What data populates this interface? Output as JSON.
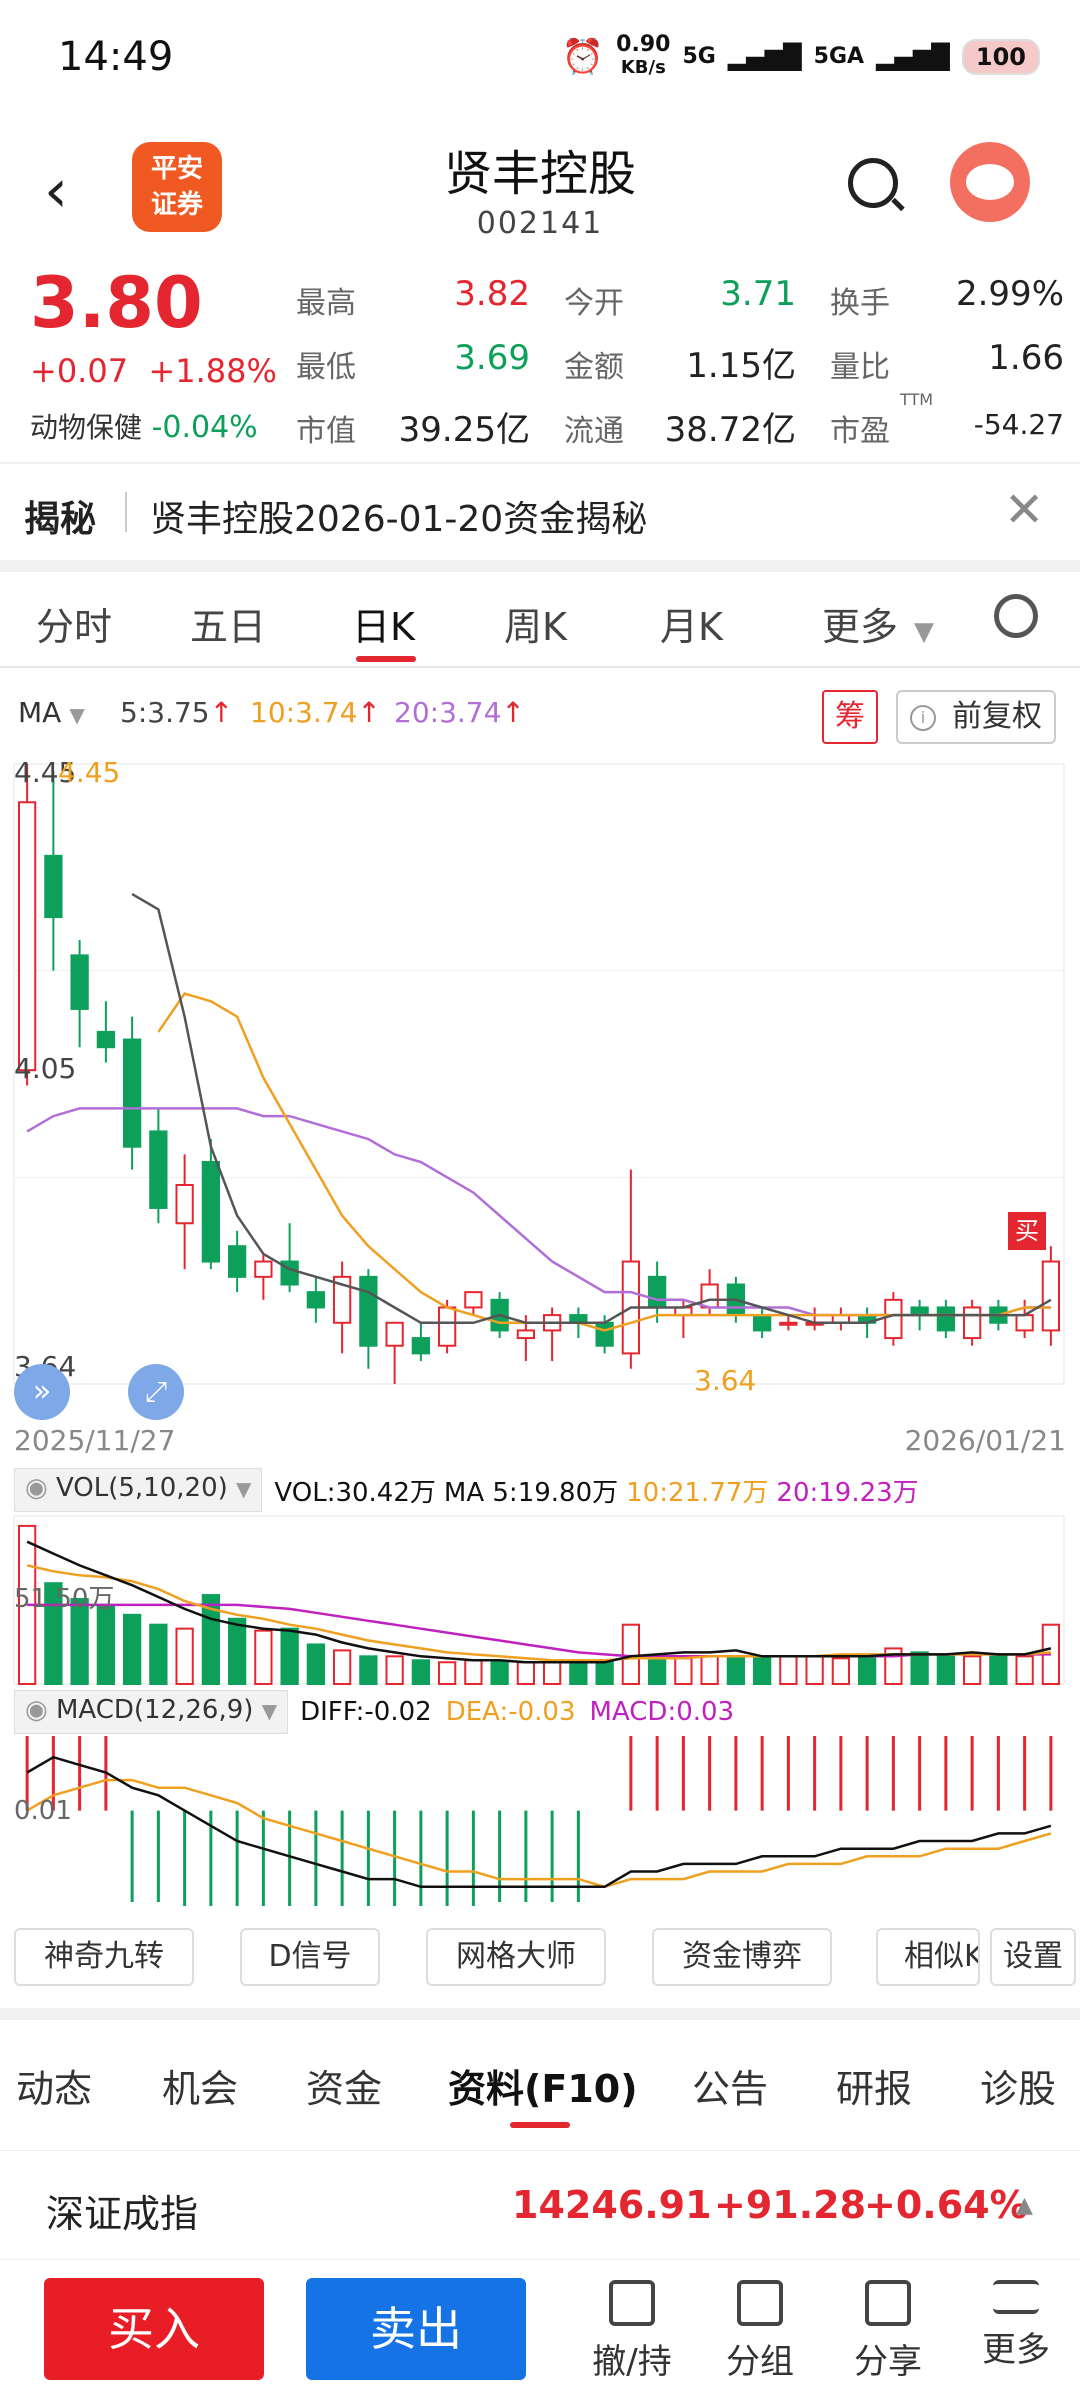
{
  "status": {
    "time": "14:49",
    "net_speed": "0.90",
    "net_unit": "KB/s",
    "sig1": "5G",
    "sig2": "5GA",
    "battery": "100"
  },
  "header": {
    "brand_line1": "平安",
    "brand_line2": "证券",
    "title": "贤丰控股",
    "code": "002141"
  },
  "quote": {
    "price": "3.80",
    "change": "+0.07",
    "change_pct": "+1.88%",
    "animal_label": "动物保健",
    "animal_value": "-0.04%",
    "fields": [
      {
        "label": "最高",
        "value": "3.82"
      },
      {
        "label": "最低",
        "value": "3.69"
      },
      {
        "label": "市值",
        "value": "39.25亿"
      },
      {
        "label": "今开",
        "value": "3.71"
      },
      {
        "label": "金额",
        "value": "1.15亿"
      },
      {
        "label": "流通",
        "value": "38.72亿"
      },
      {
        "label": "换手",
        "value": "2.99%"
      },
      {
        "label": "量比",
        "value": "1.66"
      },
      {
        "label": "市盈",
        "value": "-54.27",
        "sup": "TTM"
      }
    ]
  },
  "reveal": {
    "tag": "揭秘",
    "text": "贤丰控股2026-01-20资金揭秘"
  },
  "ktabs": [
    "分时",
    "五日",
    "日K",
    "周K",
    "月K",
    "更多"
  ],
  "ma": {
    "label": "MA",
    "ma5": "5:3.75",
    "ma10": "10:3.74",
    "ma20": "20:3.74",
    "chou": "筹",
    "fq": "前复权"
  },
  "kchart": {
    "high_label": "4.45",
    "high_mark": "4.45",
    "mid_label": "4.05",
    "low_label": "3.64",
    "low_mark": "3.64",
    "date_start": "2025/11/27",
    "date_end": "2026/01/21",
    "buy_tag": "买"
  },
  "vol": {
    "box": "VOL(5,10,20)",
    "vol": "VOL:30.42万",
    "ma5": "MA 5:19.80万",
    "ma10": "10:21.77万",
    "ma20": "20:19.23万",
    "axis": "51.50万"
  },
  "macd": {
    "box": "MACD(12,26,9)",
    "diff": "DIFF:-0.02",
    "dea": "DEA:-0.03",
    "macd": "MACD:0.03",
    "axis": "0.01"
  },
  "tools": [
    "神奇九转",
    "D信号",
    "网格大师",
    "资金博弈",
    "相似K",
    "设置"
  ],
  "itabs": [
    "动态",
    "机会",
    "资金",
    "资料(F10)",
    "公告",
    "研报",
    "诊股"
  ],
  "index": {
    "name": "深证成指",
    "value": "14246.91",
    "change": "+91.28",
    "pct": "+0.64%"
  },
  "bottom": {
    "buy": "买入",
    "sell": "卖出",
    "items": [
      "撤/持",
      "分组",
      "分享",
      "更多"
    ]
  },
  "colors": {
    "up": "#e3262f",
    "down": "#0ca05a",
    "ma5": "#555555",
    "ma10": "#f0a020",
    "ma20": "#b06ed6"
  },
  "chart_data": {
    "type": "candlestick",
    "ohlc": [
      [
        4.05,
        4.45,
        4.03,
        4.4
      ],
      [
        4.33,
        4.44,
        4.18,
        4.25
      ],
      [
        4.2,
        4.22,
        4.08,
        4.13
      ],
      [
        4.1,
        4.14,
        4.06,
        4.08
      ],
      [
        4.09,
        4.12,
        3.92,
        3.95
      ],
      [
        3.97,
        4.0,
        3.85,
        3.87
      ],
      [
        3.85,
        3.94,
        3.79,
        3.9
      ],
      [
        3.93,
        3.96,
        3.79,
        3.8
      ],
      [
        3.82,
        3.84,
        3.76,
        3.78
      ],
      [
        3.78,
        3.81,
        3.75,
        3.8
      ],
      [
        3.8,
        3.85,
        3.76,
        3.77
      ],
      [
        3.76,
        3.78,
        3.72,
        3.74
      ],
      [
        3.72,
        3.8,
        3.68,
        3.78
      ],
      [
        3.78,
        3.79,
        3.66,
        3.69
      ],
      [
        3.69,
        3.72,
        3.64,
        3.72
      ],
      [
        3.7,
        3.72,
        3.67,
        3.68
      ],
      [
        3.69,
        3.75,
        3.68,
        3.74
      ],
      [
        3.74,
        3.76,
        3.73,
        3.76
      ],
      [
        3.75,
        3.76,
        3.7,
        3.71
      ],
      [
        3.7,
        3.73,
        3.67,
        3.71
      ],
      [
        3.71,
        3.74,
        3.67,
        3.73
      ],
      [
        3.73,
        3.74,
        3.7,
        3.72
      ],
      [
        3.72,
        3.73,
        3.68,
        3.69
      ],
      [
        3.68,
        3.92,
        3.66,
        3.8
      ],
      [
        3.78,
        3.8,
        3.72,
        3.74
      ],
      [
        3.73,
        3.75,
        3.7,
        3.74
      ],
      [
        3.74,
        3.79,
        3.73,
        3.77
      ],
      [
        3.77,
        3.78,
        3.72,
        3.73
      ],
      [
        3.73,
        3.74,
        3.7,
        3.71
      ],
      [
        3.72,
        3.73,
        3.71,
        3.72
      ],
      [
        3.72,
        3.74,
        3.71,
        3.72
      ],
      [
        3.72,
        3.74,
        3.71,
        3.73
      ],
      [
        3.73,
        3.74,
        3.7,
        3.72
      ],
      [
        3.7,
        3.76,
        3.69,
        3.75
      ],
      [
        3.74,
        3.75,
        3.71,
        3.73
      ],
      [
        3.74,
        3.75,
        3.7,
        3.71
      ],
      [
        3.7,
        3.75,
        3.69,
        3.74
      ],
      [
        3.74,
        3.75,
        3.71,
        3.72
      ],
      [
        3.71,
        3.75,
        3.7,
        3.73
      ],
      [
        3.71,
        3.82,
        3.69,
        3.8
      ]
    ],
    "ma5": [
      null,
      null,
      null,
      null,
      4.28,
      4.26,
      4.12,
      3.95,
      3.86,
      3.81,
      3.79,
      3.78,
      3.77,
      3.76,
      3.74,
      3.72,
      3.72,
      3.72,
      3.73,
      3.72,
      3.72,
      3.72,
      3.72,
      3.74,
      3.74,
      3.74,
      3.75,
      3.75,
      3.74,
      3.73,
      3.72,
      3.72,
      3.72,
      3.73,
      3.73,
      3.73,
      3.73,
      3.73,
      3.73,
      3.75
    ],
    "ma10": [
      null,
      null,
      null,
      null,
      null,
      4.1,
      4.15,
      4.14,
      4.12,
      4.04,
      3.98,
      3.92,
      3.86,
      3.82,
      3.79,
      3.76,
      3.74,
      3.73,
      3.72,
      3.72,
      3.72,
      3.72,
      3.71,
      3.72,
      3.73,
      3.73,
      3.73,
      3.73,
      3.73,
      3.73,
      3.73,
      3.73,
      3.73,
      3.73,
      3.73,
      3.73,
      3.73,
      3.73,
      3.74,
      3.74
    ],
    "ma20": [
      3.97,
      3.99,
      4.0,
      4.0,
      4.0,
      4.0,
      4.0,
      4.0,
      4.0,
      3.99,
      3.99,
      3.98,
      3.97,
      3.96,
      3.94,
      3.93,
      3.91,
      3.89,
      3.86,
      3.83,
      3.8,
      3.78,
      3.76,
      3.76,
      3.75,
      3.75,
      3.74,
      3.74,
      3.74,
      3.74,
      3.73,
      3.73,
      3.73,
      3.73,
      3.73,
      3.73,
      3.73,
      3.73,
      3.74,
      3.74
    ],
    "vol": [
      80,
      51,
      43,
      40,
      35,
      30,
      28,
      45,
      33,
      27,
      28,
      20,
      17,
      14,
      14,
      12,
      11,
      12,
      11,
      11,
      11,
      12,
      11,
      30,
      14,
      13,
      14,
      14,
      13,
      14,
      14,
      13,
      15,
      18,
      16,
      15,
      14,
      14,
      14,
      30
    ],
    "vol_ma5": [
      72,
      66,
      60,
      55,
      50,
      44,
      38,
      33,
      30,
      28,
      27,
      25,
      21,
      18,
      16,
      14,
      13,
      12,
      12,
      11,
      11,
      11,
      11,
      14,
      15,
      16,
      16,
      17,
      14,
      14,
      14,
      14,
      14,
      15,
      15,
      15,
      16,
      15,
      15,
      18
    ],
    "vol_ma10": [
      60,
      57,
      55,
      54,
      52,
      48,
      42,
      38,
      35,
      33,
      30,
      28,
      25,
      22,
      20,
      18,
      16,
      15,
      14,
      13,
      12,
      12,
      12,
      13,
      13,
      13,
      14,
      14,
      14,
      14,
      14,
      15,
      15,
      15,
      15,
      15,
      15,
      15,
      15,
      16
    ],
    "vol_ma20": [
      40,
      40,
      40,
      40,
      40,
      40,
      40,
      40,
      40,
      39,
      38,
      36,
      34,
      32,
      30,
      28,
      26,
      24,
      22,
      20,
      18,
      16,
      15,
      14,
      14,
      14,
      14,
      14,
      14,
      14,
      14,
      14,
      14,
      14,
      15,
      15,
      15,
      15,
      15,
      15
    ],
    "dif": [
      0.05,
      0.07,
      0.06,
      0.05,
      0.03,
      0.02,
      0.0,
      -0.02,
      -0.04,
      -0.05,
      -0.06,
      -0.07,
      -0.08,
      -0.09,
      -0.09,
      -0.1,
      -0.1,
      -0.1,
      -0.1,
      -0.1,
      -0.1,
      -0.1,
      -0.1,
      -0.08,
      -0.08,
      -0.07,
      -0.07,
      -0.07,
      -0.06,
      -0.06,
      -0.06,
      -0.05,
      -0.05,
      -0.05,
      -0.04,
      -0.04,
      -0.04,
      -0.03,
      -0.03,
      -0.02
    ],
    "dea": [
      0.0,
      0.02,
      0.03,
      0.04,
      0.04,
      0.03,
      0.03,
      0.02,
      0.01,
      -0.01,
      -0.02,
      -0.03,
      -0.04,
      -0.05,
      -0.06,
      -0.07,
      -0.08,
      -0.08,
      -0.09,
      -0.09,
      -0.09,
      -0.09,
      -0.1,
      -0.09,
      -0.09,
      -0.09,
      -0.08,
      -0.08,
      -0.08,
      -0.07,
      -0.07,
      -0.07,
      -0.06,
      -0.06,
      -0.06,
      -0.05,
      -0.05,
      -0.05,
      -0.04,
      -0.03
    ],
    "ylim": [
      3.64,
      4.45
    ]
  }
}
